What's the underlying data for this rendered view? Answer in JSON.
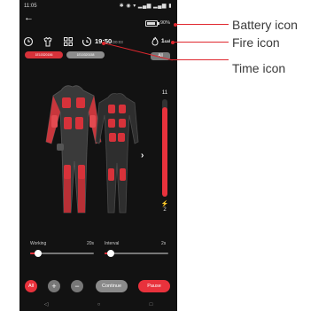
{
  "status_bar": {
    "time": "11:05",
    "icons": "✱ ◉ ▾ ▂▄▆ ▂▄▆ ▮"
  },
  "header": {
    "back_icon": "arrow-left-icon",
    "battery": {
      "percent_label": "90%",
      "level": 0.9
    }
  },
  "toolbar": {
    "timer_icon": "clock-icon",
    "body_icon": "body-shirt-icon",
    "grid_icon": "grid-icon",
    "time_icon": "timer-icon",
    "time": "19:50",
    "time_total": "/20:03",
    "fire_icon": "fire-icon",
    "calories": "1",
    "calories_unit": "cal"
  },
  "devices": {
    "selected": "1E10320156",
    "other": "1E10320158",
    "all_label": "All"
  },
  "intensity": {
    "value_top": "11",
    "value_bottom": "2",
    "level": 0.92,
    "bolt": "⚡"
  },
  "sliders": {
    "working": {
      "label": "Working",
      "value": "20s",
      "position": 0.12
    },
    "interval": {
      "label": "Interval",
      "value": "2s",
      "position": 0.1
    }
  },
  "bottom_bar": {
    "all": "All",
    "plus": "+",
    "minus": "−",
    "continue": "Continue",
    "pause": "Pause"
  },
  "nav": {
    "back": "◁",
    "home": "○",
    "recent": "□"
  },
  "annotations": {
    "battery": "Battery icon",
    "fire": "Fire icon",
    "time": "Time icon"
  },
  "colors": {
    "accent": "#e8323c",
    "background": "#121212",
    "annotation_line": "#e0282f"
  }
}
